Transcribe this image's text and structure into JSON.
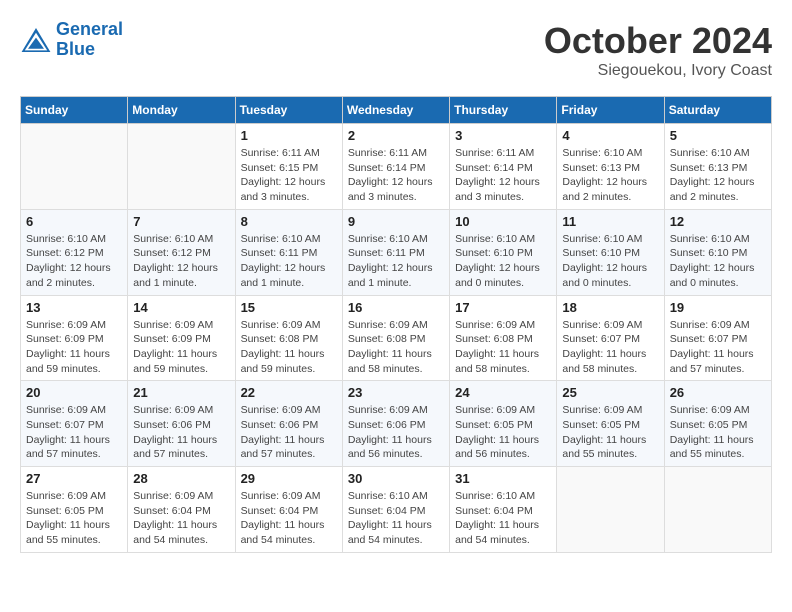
{
  "logo": {
    "line1": "General",
    "line2": "Blue"
  },
  "title": "October 2024",
  "subtitle": "Siegouekou, Ivory Coast",
  "days_of_week": [
    "Sunday",
    "Monday",
    "Tuesday",
    "Wednesday",
    "Thursday",
    "Friday",
    "Saturday"
  ],
  "weeks": [
    [
      {
        "day": "",
        "info": ""
      },
      {
        "day": "",
        "info": ""
      },
      {
        "day": "1",
        "info": "Sunrise: 6:11 AM\nSunset: 6:15 PM\nDaylight: 12 hours and 3 minutes."
      },
      {
        "day": "2",
        "info": "Sunrise: 6:11 AM\nSunset: 6:14 PM\nDaylight: 12 hours and 3 minutes."
      },
      {
        "day": "3",
        "info": "Sunrise: 6:11 AM\nSunset: 6:14 PM\nDaylight: 12 hours and 3 minutes."
      },
      {
        "day": "4",
        "info": "Sunrise: 6:10 AM\nSunset: 6:13 PM\nDaylight: 12 hours and 2 minutes."
      },
      {
        "day": "5",
        "info": "Sunrise: 6:10 AM\nSunset: 6:13 PM\nDaylight: 12 hours and 2 minutes."
      }
    ],
    [
      {
        "day": "6",
        "info": "Sunrise: 6:10 AM\nSunset: 6:12 PM\nDaylight: 12 hours and 2 minutes."
      },
      {
        "day": "7",
        "info": "Sunrise: 6:10 AM\nSunset: 6:12 PM\nDaylight: 12 hours and 1 minute."
      },
      {
        "day": "8",
        "info": "Sunrise: 6:10 AM\nSunset: 6:11 PM\nDaylight: 12 hours and 1 minute."
      },
      {
        "day": "9",
        "info": "Sunrise: 6:10 AM\nSunset: 6:11 PM\nDaylight: 12 hours and 1 minute."
      },
      {
        "day": "10",
        "info": "Sunrise: 6:10 AM\nSunset: 6:10 PM\nDaylight: 12 hours and 0 minutes."
      },
      {
        "day": "11",
        "info": "Sunrise: 6:10 AM\nSunset: 6:10 PM\nDaylight: 12 hours and 0 minutes."
      },
      {
        "day": "12",
        "info": "Sunrise: 6:10 AM\nSunset: 6:10 PM\nDaylight: 12 hours and 0 minutes."
      }
    ],
    [
      {
        "day": "13",
        "info": "Sunrise: 6:09 AM\nSunset: 6:09 PM\nDaylight: 11 hours and 59 minutes."
      },
      {
        "day": "14",
        "info": "Sunrise: 6:09 AM\nSunset: 6:09 PM\nDaylight: 11 hours and 59 minutes."
      },
      {
        "day": "15",
        "info": "Sunrise: 6:09 AM\nSunset: 6:08 PM\nDaylight: 11 hours and 59 minutes."
      },
      {
        "day": "16",
        "info": "Sunrise: 6:09 AM\nSunset: 6:08 PM\nDaylight: 11 hours and 58 minutes."
      },
      {
        "day": "17",
        "info": "Sunrise: 6:09 AM\nSunset: 6:08 PM\nDaylight: 11 hours and 58 minutes."
      },
      {
        "day": "18",
        "info": "Sunrise: 6:09 AM\nSunset: 6:07 PM\nDaylight: 11 hours and 58 minutes."
      },
      {
        "day": "19",
        "info": "Sunrise: 6:09 AM\nSunset: 6:07 PM\nDaylight: 11 hours and 57 minutes."
      }
    ],
    [
      {
        "day": "20",
        "info": "Sunrise: 6:09 AM\nSunset: 6:07 PM\nDaylight: 11 hours and 57 minutes."
      },
      {
        "day": "21",
        "info": "Sunrise: 6:09 AM\nSunset: 6:06 PM\nDaylight: 11 hours and 57 minutes."
      },
      {
        "day": "22",
        "info": "Sunrise: 6:09 AM\nSunset: 6:06 PM\nDaylight: 11 hours and 57 minutes."
      },
      {
        "day": "23",
        "info": "Sunrise: 6:09 AM\nSunset: 6:06 PM\nDaylight: 11 hours and 56 minutes."
      },
      {
        "day": "24",
        "info": "Sunrise: 6:09 AM\nSunset: 6:05 PM\nDaylight: 11 hours and 56 minutes."
      },
      {
        "day": "25",
        "info": "Sunrise: 6:09 AM\nSunset: 6:05 PM\nDaylight: 11 hours and 55 minutes."
      },
      {
        "day": "26",
        "info": "Sunrise: 6:09 AM\nSunset: 6:05 PM\nDaylight: 11 hours and 55 minutes."
      }
    ],
    [
      {
        "day": "27",
        "info": "Sunrise: 6:09 AM\nSunset: 6:05 PM\nDaylight: 11 hours and 55 minutes."
      },
      {
        "day": "28",
        "info": "Sunrise: 6:09 AM\nSunset: 6:04 PM\nDaylight: 11 hours and 54 minutes."
      },
      {
        "day": "29",
        "info": "Sunrise: 6:09 AM\nSunset: 6:04 PM\nDaylight: 11 hours and 54 minutes."
      },
      {
        "day": "30",
        "info": "Sunrise: 6:10 AM\nSunset: 6:04 PM\nDaylight: 11 hours and 54 minutes."
      },
      {
        "day": "31",
        "info": "Sunrise: 6:10 AM\nSunset: 6:04 PM\nDaylight: 11 hours and 54 minutes."
      },
      {
        "day": "",
        "info": ""
      },
      {
        "day": "",
        "info": ""
      }
    ]
  ]
}
